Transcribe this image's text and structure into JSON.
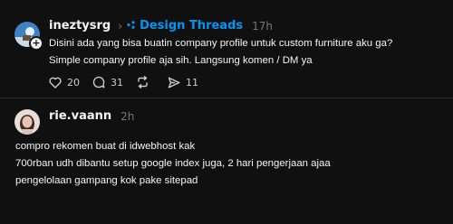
{
  "post": {
    "username": "ineztysrg",
    "community": "Design Threads",
    "time": "17h",
    "lines": [
      "Disini ada yang bisa buatin company profile untuk custom furniture aku ga?",
      "Simple company profile aja sih. Langsung komen / DM ya"
    ],
    "actions": {
      "like_count": "20",
      "comment_count": "31",
      "repost_count": "",
      "share_count": "11"
    }
  },
  "reply": {
    "username": "rie.vaann",
    "time": "2h",
    "lines": [
      "compro rekomen buat di idwebhost kak",
      "700rban udh dibantu setup google index juga, 2 hari pengerjaan ajaa",
      "pengelolaan gampang kok pake sitepad"
    ]
  },
  "colors": {
    "background": "#101010",
    "text": "#f3f5f7",
    "muted": "#777777",
    "accent": "#0095f6"
  },
  "icons": [
    "follow-plus-icon",
    "threads-icon",
    "heart-icon",
    "comment-icon",
    "repost-icon",
    "share-icon"
  ]
}
